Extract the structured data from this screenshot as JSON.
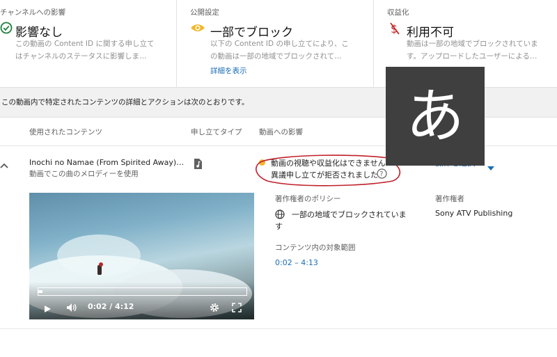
{
  "summary": [
    {
      "title": "チャンネルへの影響",
      "value": "影響なし",
      "desc1": "この動画の Content ID に関する申し立て",
      "desc2": "はチャンネルのステータスに影響しま…"
    },
    {
      "title": "公開設定",
      "value": "一部でブロック",
      "desc1": "以下の Content ID の申し立てにより、こ",
      "desc2": "の動画は一部の地域でブロックされて…",
      "link": "詳細を表示"
    },
    {
      "title": "収益化",
      "value": "利用不可",
      "desc1": "動画は一部の地域でブロックされていま",
      "desc2": "す。アップロードしたユーザーによる…"
    }
  ],
  "band_text": "この動画内で特定されたコンテンツの詳細とアクションは次のとおりです。",
  "columns": [
    "使用されたコンテンツ",
    "申し立てタイプ",
    "動画への影響"
  ],
  "claim": {
    "title": "Inochi no Namae (From Spirited Away)…",
    "subtitle": "動画でこの曲のメロディーを使用",
    "impact_line1": "動画の視聴や収益化はできません",
    "impact_line2": "異議申し立てが拒否されました",
    "action_label": "操作を選択",
    "policy_label": "著作権者のポリシー",
    "policy_value_1": "一部の地域でブロックされていま",
    "policy_value_2": "す",
    "owner_label": "著作権者",
    "owner_value": "Sony ATV Publishing",
    "range_label": "コンテンツ内の対象範囲",
    "range_value": "0:02 – 4:13"
  },
  "player": {
    "time": "0:02 / 4:12",
    "progress": 0.008
  },
  "overlay_char": "あ",
  "colors": {
    "link": "#1a6eb5",
    "warning": "#f3b52a",
    "annotation": "#c0202a",
    "overlay_bg": "#3f3f3f"
  }
}
